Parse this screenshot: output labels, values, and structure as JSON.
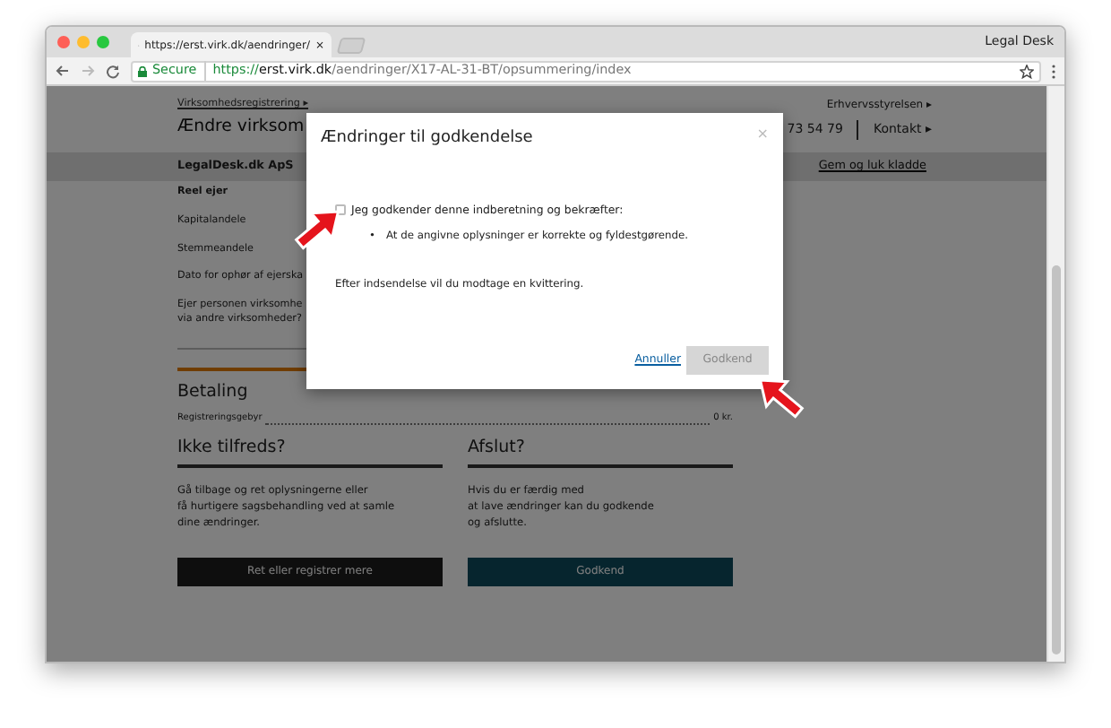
{
  "browser": {
    "tab_title": "https://erst.virk.dk/aendringer/",
    "tab_close": "×",
    "profile_name": "Legal Desk",
    "secure_label": "Secure",
    "url_scheme": "https://",
    "url_host": "erst.virk.dk",
    "url_path": "/aendringer/X17-AL-31-BT/opsummering/index"
  },
  "header": {
    "breadcrumb": "Virksomhedsregistrering ▸",
    "title": "Ændre virksom",
    "agency_link": "Erhvervsstyrelsen ▸",
    "phone": "73 54 79",
    "contact_link": "Kontakt ▸"
  },
  "company_bar": {
    "name": "LegalDesk.dk ApS",
    "link": "Gem og luk kladde"
  },
  "sidebar": {
    "items": [
      {
        "lines": [
          "Reel ejer"
        ],
        "active": true
      },
      {
        "lines": [
          "Kapitalandele"
        ],
        "active": false
      },
      {
        "lines": [
          "Stemmeandele"
        ],
        "active": false
      },
      {
        "lines": [
          "Dato for ophør af ejerska"
        ],
        "active": false
      },
      {
        "lines": [
          "Ejer personen virksomhe",
          "via andre virksomheder?"
        ],
        "active": false
      }
    ]
  },
  "payment": {
    "heading": "Betaling",
    "fee_label": "Registreringsgebyr",
    "fee_value": "0 kr."
  },
  "sections": [
    {
      "heading": "Ikke tilfreds?",
      "lines": [
        "Gå tilbage og ret oplysningerne eller",
        "få hurtigere sagsbehandling ved at samle",
        "dine ændringer."
      ],
      "button": "Ret eller registrer mere",
      "kind": "dark"
    },
    {
      "heading": "Afslut?",
      "lines": [
        "Hvis du er færdig med",
        "at lave ændringer kan du godkende",
        "og afslutte."
      ],
      "button": "Godkend",
      "kind": "teal"
    }
  ],
  "modal": {
    "title": "Ændringer til godkendelse",
    "close": "×",
    "checkbox": {
      "label": "Jeg godkender denne indberetning og bekræfter:",
      "checked": false
    },
    "bullets": [
      {
        "marker": "•",
        "text": "At de angivne oplysninger er korrekte og fyldestgørende."
      }
    ],
    "note": "Efter indsendelse vil du modtage en kvittering.",
    "cancel": "Annuller",
    "confirm": {
      "label": "Godkend",
      "disabled": true
    }
  }
}
